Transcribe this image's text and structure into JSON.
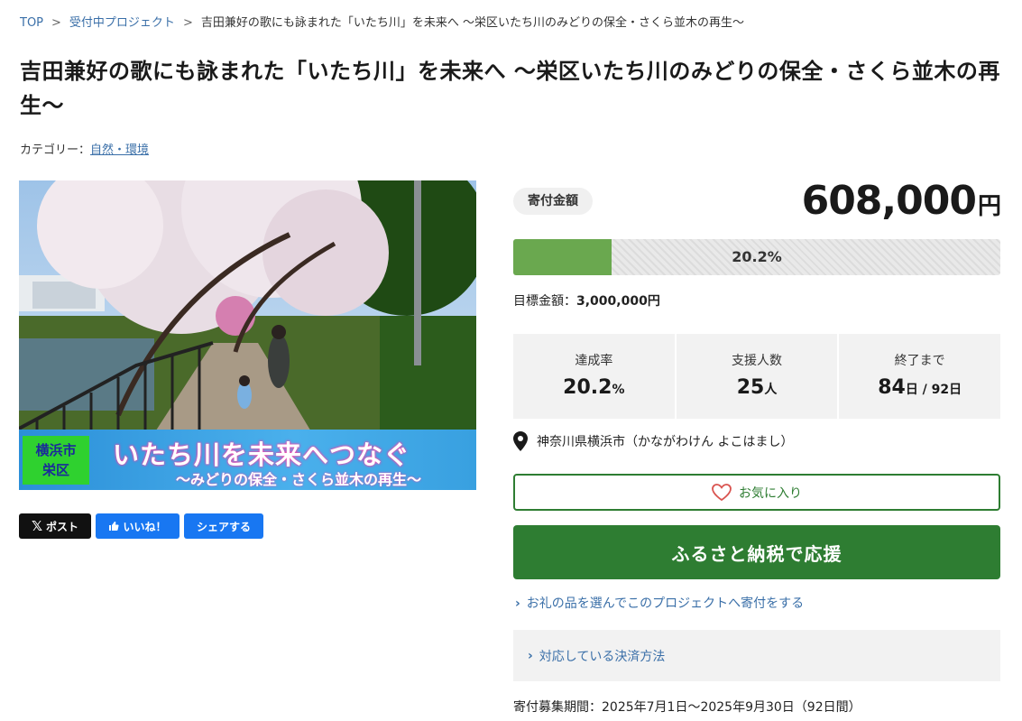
{
  "breadcrumb": {
    "top": "TOP",
    "projects": "受付中プロジェクト",
    "current": "吉田兼好の歌にも詠まれた「いたち川」を未来へ 〜栄区いたち川のみどりの保全・さくら並木の再生〜"
  },
  "page_title": "吉田兼好の歌にも詠まれた「いたち川」を未来へ 〜栄区いたち川のみどりの保全・さくら並木の再生〜",
  "category": {
    "label": "カテゴリー：",
    "value": "自然・環境"
  },
  "hero": {
    "badge_line1": "横浜市",
    "badge_line2": "栄区",
    "main": "いたち川を未来へつなぐ",
    "sub": "〜みどりの保全・さくら並木の再生〜"
  },
  "share": {
    "x": "ポスト",
    "like": "いいね！",
    "share": "シェアする"
  },
  "donation": {
    "label": "寄付金額",
    "amount": "608,000",
    "unit": "円",
    "progress_percent": 20.2,
    "progress_text": "20.2%",
    "target_label": "目標金額：",
    "target_value": "3,000,000円"
  },
  "stats": [
    {
      "label": "達成率",
      "value": "20.2",
      "unit": "%"
    },
    {
      "label": "支援人数",
      "value": "25",
      "unit": "人"
    },
    {
      "label": "終了まで",
      "value": "84",
      "unit": "日 / 92日"
    }
  ],
  "location": "神奈川県横浜市（かながわけん よこはまし）",
  "favorite": "お気に入り",
  "donate_button": "ふるさと納税で応援",
  "gift_link": "お礼の品を選んでこのプロジェクトへ寄付をする",
  "payment_link": "対応している決済方法",
  "period": "寄付募集期間：2025年7月1日〜2025年9月30日（92日間）",
  "colors": {
    "accent_green": "#2e7d32",
    "progress_green": "#6aa84f",
    "link_blue": "#3a6fa8",
    "facebook_blue": "#1877f2"
  }
}
